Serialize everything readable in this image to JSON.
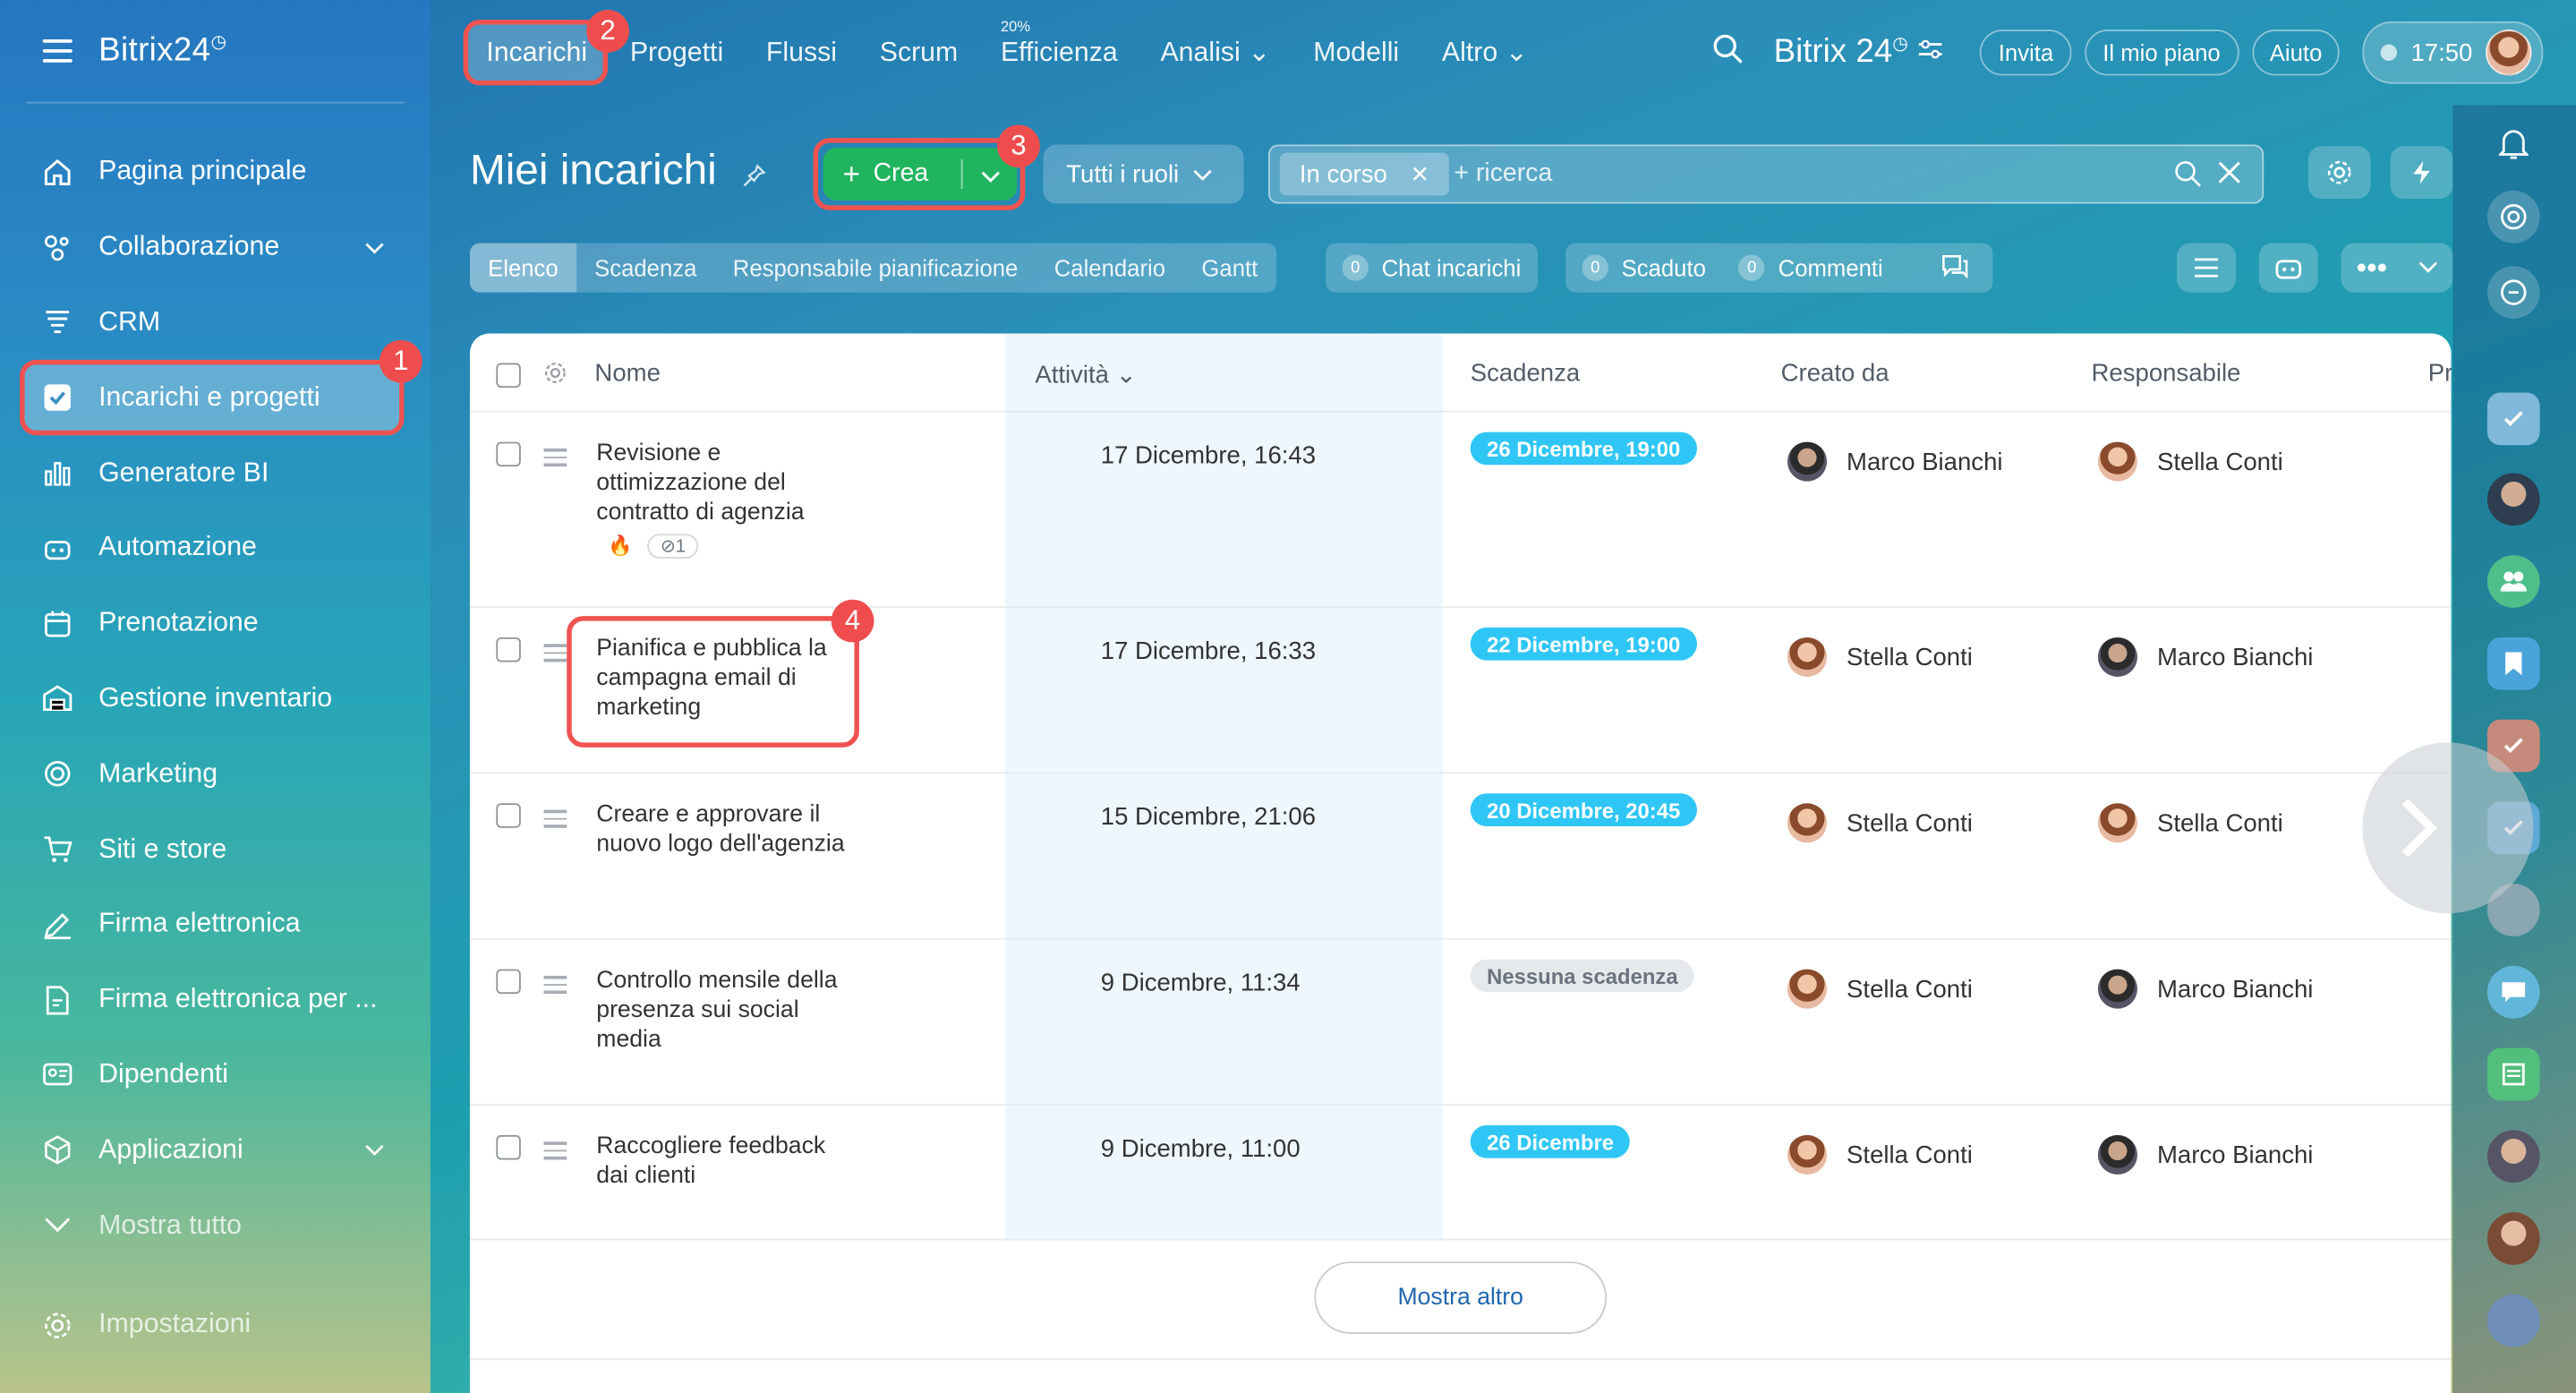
{
  "sidebar": {
    "brand": "Bitrix24",
    "items": [
      {
        "label": "Pagina principale",
        "icon": "home-icon"
      },
      {
        "label": "Collaborazione",
        "icon": "collab-icon"
      },
      {
        "label": "CRM",
        "icon": "crm-icon"
      },
      {
        "label": "Incarichi e progetti",
        "icon": "tasks-check-icon"
      },
      {
        "label": "Generatore BI",
        "icon": "bi-chart-icon"
      },
      {
        "label": "Automazione",
        "icon": "robot-icon"
      },
      {
        "label": "Prenotazione",
        "icon": "calendar-icon"
      },
      {
        "label": "Gestione inventario",
        "icon": "warehouse-icon"
      },
      {
        "label": "Marketing",
        "icon": "target-icon"
      },
      {
        "label": "Siti e store",
        "icon": "cart-icon"
      },
      {
        "label": "Firma elettronica",
        "icon": "pen-icon"
      },
      {
        "label": "Firma elettronica per ...",
        "icon": "doc-sign-icon"
      },
      {
        "label": "Dipendenti",
        "icon": "id-card-icon"
      },
      {
        "label": "Applicazioni",
        "icon": "cube-icon"
      },
      {
        "label": "Mostra tutto",
        "icon": "chevron-down-icon"
      }
    ],
    "settings_label": "Impostazioni"
  },
  "topnav": {
    "items": [
      "Incarichi",
      "Progetti",
      "Flussi",
      "Scrum",
      "Efficienza",
      "Analisi",
      "Modelli",
      "Altro"
    ],
    "efficienza_sup": "20%",
    "brand": "Bitrix 24",
    "invite": "Invita",
    "plan": "Il mio piano",
    "help": "Aiuto",
    "clock": "17:50"
  },
  "header": {
    "title": "Miei incarichi",
    "create_label": "Crea",
    "roles_label": "Tutti i ruoli",
    "filter_chip": "In corso",
    "search_placeholder": "+ ricerca"
  },
  "tabs": [
    "Elenco",
    "Scadenza",
    "Responsabile pianificazione",
    "Calendario",
    "Gantt"
  ],
  "counters": {
    "chat_count": "0",
    "chat_label": "Chat incarichi",
    "overdue_count": "0",
    "overdue_label": "Scaduto",
    "comments_count": "0",
    "comments_label": "Commenti"
  },
  "table": {
    "columns": {
      "name": "Nome",
      "activity": "Attività",
      "deadline": "Scadenza",
      "created_by": "Creato da",
      "responsible": "Responsabile",
      "extra": "Pr"
    },
    "rows": [
      {
        "name": "Revisione e ottimizzazione del contratto di agenzia",
        "activity": "17 Dicembre, 16:43",
        "deadline": "26 Dicembre, 19:00",
        "creator": "Marco Bianchi",
        "responsible": "Stella Conti",
        "attachments": "1"
      },
      {
        "name": "Pianifica e pubblica la campagna email di marketing",
        "activity": "17 Dicembre, 16:33",
        "deadline": "22 Dicembre, 19:00",
        "creator": "Stella Conti",
        "responsible": "Marco Bianchi"
      },
      {
        "name": "Creare e approvare il nuovo logo dell'agenzia",
        "activity": "15 Dicembre, 21:06",
        "deadline": "20 Dicembre, 20:45",
        "creator": "Stella Conti",
        "responsible": "Stella Conti"
      },
      {
        "name": "Controllo mensile della presenza sui social media",
        "activity": "9 Dicembre, 11:34",
        "deadline": "Nessuna scadenza",
        "creator": "Stella Conti",
        "responsible": "Marco Bianchi"
      },
      {
        "name": "Raccogliere feedback dai clienti",
        "activity": "9 Dicembre, 11:00",
        "deadline": "26 Dicembre",
        "creator": "Stella Conti",
        "responsible": "Marco Bianchi"
      }
    ],
    "show_more": "Mostra altro"
  },
  "annotations": [
    "1",
    "2",
    "3",
    "4"
  ],
  "colors": {
    "accent_red": "#ef4d4d",
    "create_green": "#21b45f",
    "deadline_blue": "#2fc6f6"
  }
}
